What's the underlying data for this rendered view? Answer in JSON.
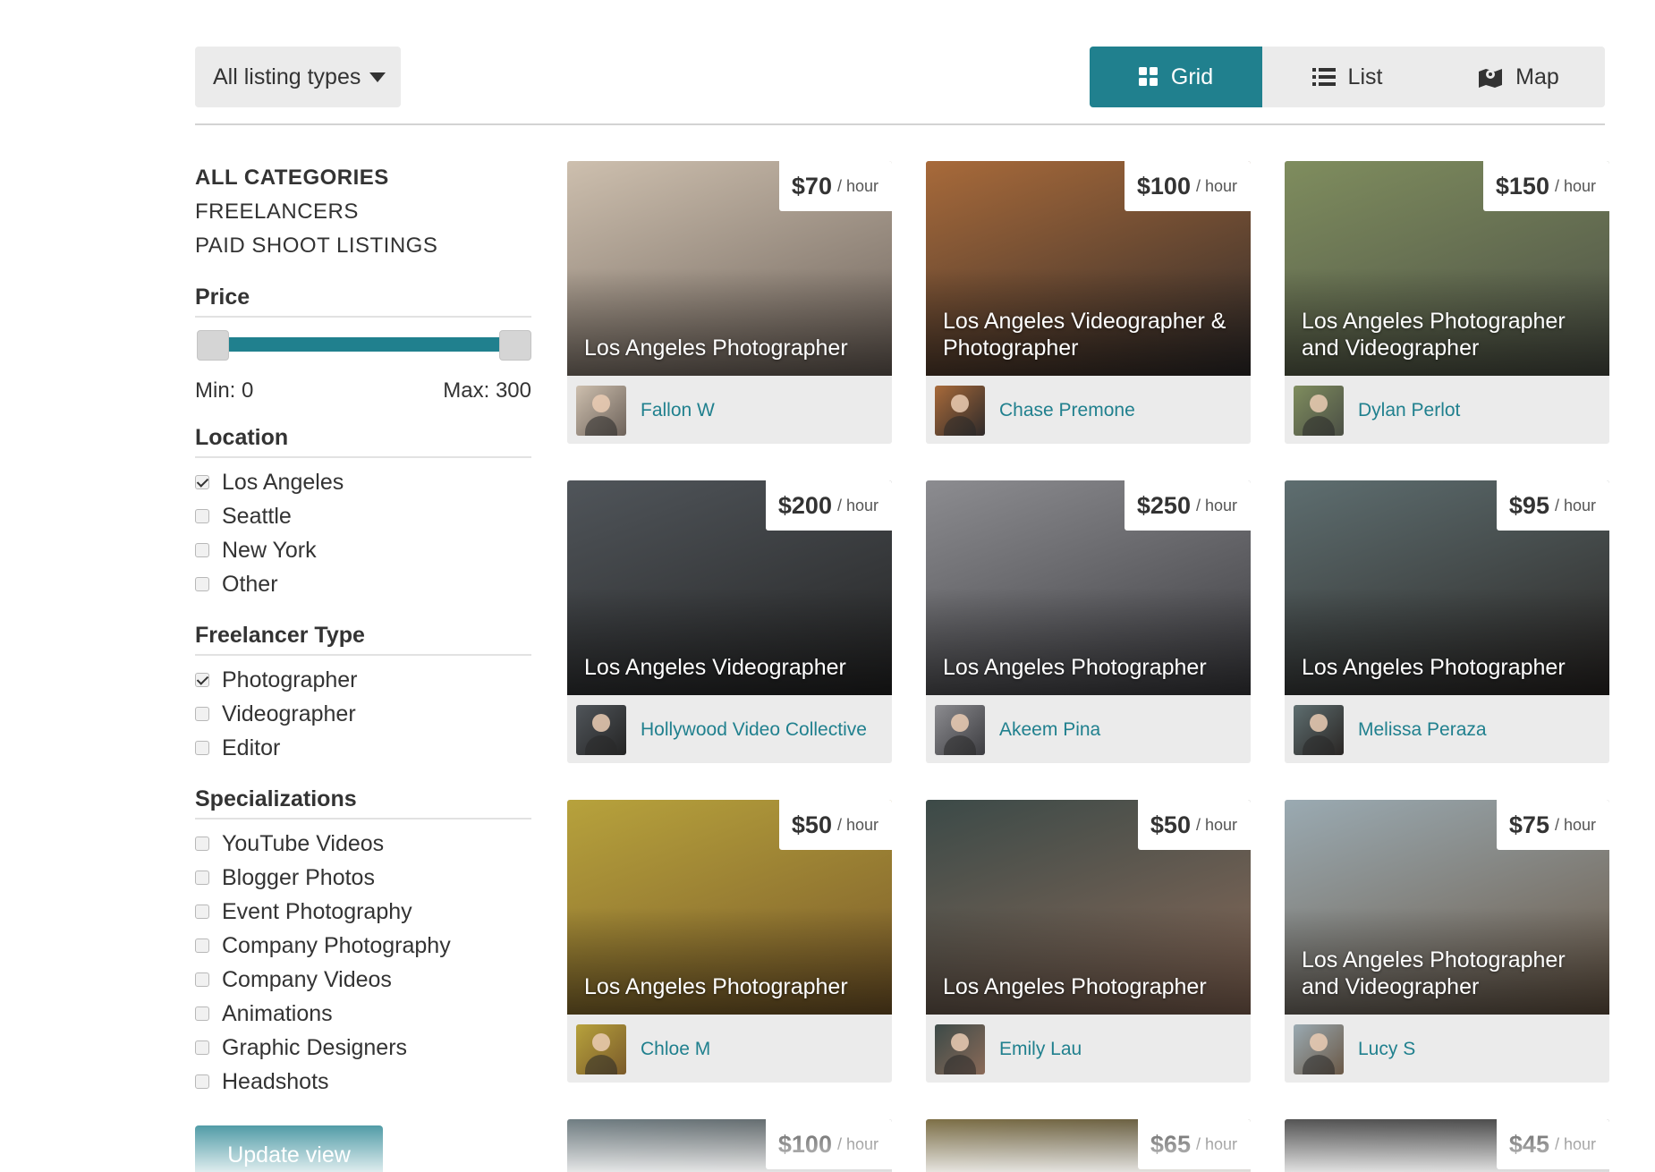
{
  "toolbar": {
    "listing_types_label": "All listing types",
    "views": [
      {
        "label": "Grid",
        "icon": "grid-icon",
        "active": true
      },
      {
        "label": "List",
        "icon": "list-icon",
        "active": false
      },
      {
        "label": "Map",
        "icon": "map-icon",
        "active": false
      }
    ]
  },
  "sidebar": {
    "categories": [
      "ALL CATEGORIES",
      "FREELANCERS",
      "PAID SHOOT LISTINGS"
    ],
    "price": {
      "title": "Price",
      "min_label": "Min: 0",
      "max_label": "Max: 300",
      "min": 0,
      "max": 300
    },
    "location": {
      "title": "Location",
      "options": [
        {
          "label": "Los Angeles",
          "checked": true
        },
        {
          "label": "Seattle",
          "checked": false
        },
        {
          "label": "New York",
          "checked": false
        },
        {
          "label": "Other",
          "checked": false
        }
      ]
    },
    "freelancer_type": {
      "title": "Freelancer Type",
      "options": [
        {
          "label": "Photographer",
          "checked": true
        },
        {
          "label": "Videographer",
          "checked": false
        },
        {
          "label": "Editor",
          "checked": false
        }
      ]
    },
    "specializations": {
      "title": "Specializations",
      "options": [
        {
          "label": "YouTube Videos",
          "checked": false
        },
        {
          "label": "Blogger Photos",
          "checked": false
        },
        {
          "label": "Event Photography",
          "checked": false
        },
        {
          "label": "Company Photography",
          "checked": false
        },
        {
          "label": "Company Videos",
          "checked": false
        },
        {
          "label": "Animations",
          "checked": false
        },
        {
          "label": "Graphic Designers",
          "checked": false
        },
        {
          "label": "Headshots",
          "checked": false
        }
      ]
    },
    "update_button": "Update view"
  },
  "listings": [
    {
      "title": "Los Angeles Photographer",
      "price": "$70",
      "unit": "/ hour",
      "author": "Fallon W",
      "colors": [
        "#cdbfae",
        "#6d625a"
      ]
    },
    {
      "title": "Los Angeles Videographer & Photographer",
      "price": "$100",
      "unit": "/ hour",
      "author": "Chase Premone",
      "colors": [
        "#a86a3a",
        "#2e2a2a"
      ]
    },
    {
      "title": "Los Angeles Photographer and Videographer",
      "price": "$150",
      "unit": "/ hour",
      "author": "Dylan Perlot",
      "colors": [
        "#7f8d5e",
        "#4b4f45"
      ]
    },
    {
      "title": "Los Angeles Videographer",
      "price": "$200",
      "unit": "/ hour",
      "author": "Hollywood Video Collective",
      "colors": [
        "#50555a",
        "#242424"
      ]
    },
    {
      "title": "Los Angeles Photographer",
      "price": "$250",
      "unit": "/ hour",
      "author": "Akeem Pina",
      "colors": [
        "#8c8c90",
        "#3c3c40"
      ]
    },
    {
      "title": "Los Angeles Photographer",
      "price": "$95",
      "unit": "/ hour",
      "author": "Melissa Peraza",
      "colors": [
        "#5e6e70",
        "#2a2624"
      ]
    },
    {
      "title": "Los Angeles Photographer",
      "price": "$50",
      "unit": "/ hour",
      "author": "Chloe M",
      "colors": [
        "#b7a23c",
        "#7a5a2a"
      ]
    },
    {
      "title": "Los Angeles Photographer",
      "price": "$50",
      "unit": "/ hour",
      "author": "Emily Lau",
      "colors": [
        "#3c4a48",
        "#8a6a58"
      ]
    },
    {
      "title": "Los Angeles Photographer and Videographer",
      "price": "$75",
      "unit": "/ hour",
      "author": "Lucy S",
      "colors": [
        "#9aaab2",
        "#6a5846"
      ]
    },
    {
      "title": "",
      "price": "$100",
      "unit": "/ hour",
      "author": "",
      "colors": [
        "#5a6a70",
        "#3a3a3a"
      ]
    },
    {
      "title": "",
      "price": "$65",
      "unit": "/ hour",
      "author": "",
      "colors": [
        "#6a5a2a",
        "#3a3220"
      ]
    },
    {
      "title": "",
      "price": "$45",
      "unit": "/ hour",
      "author": "",
      "colors": [
        "#3a3a3a",
        "#262626"
      ]
    }
  ],
  "theme": {
    "accent": "#20808e",
    "panel": "#ebebeb"
  }
}
